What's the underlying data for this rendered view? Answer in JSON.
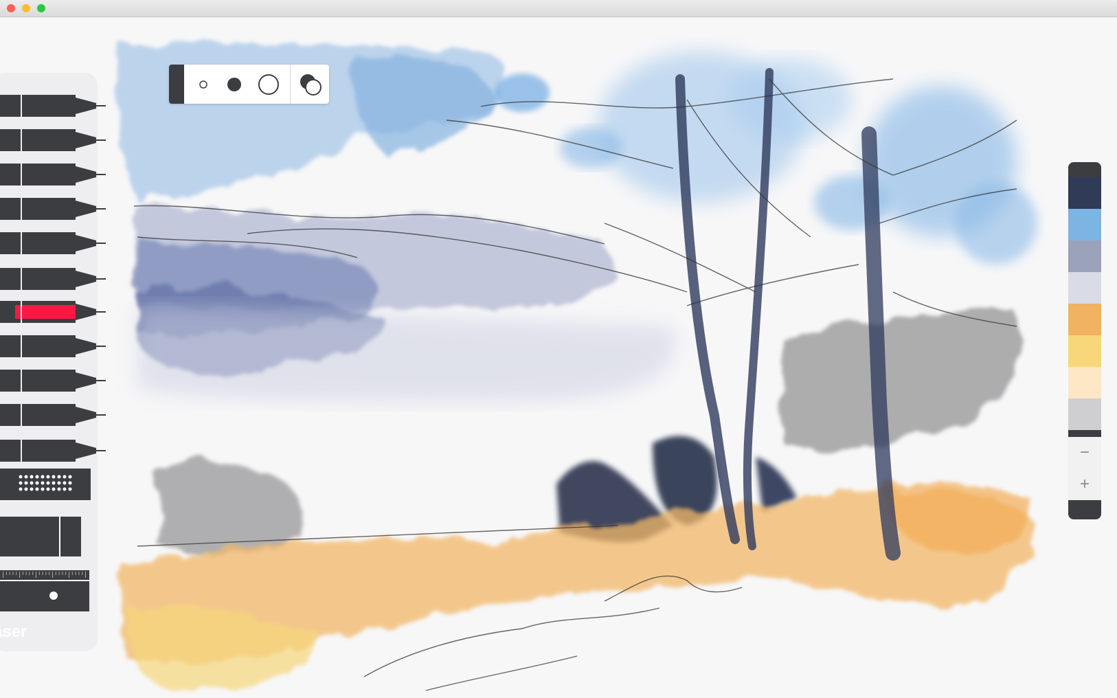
{
  "window": {
    "traffic_lights": [
      {
        "name": "close",
        "color": "#fe5f57"
      },
      {
        "name": "minimize",
        "color": "#febc2e"
      },
      {
        "name": "zoom",
        "color": "#28c840"
      }
    ]
  },
  "tools": {
    "items": [
      {
        "name": "technical-pen-tool"
      },
      {
        "name": "fineliner-tool"
      },
      {
        "name": "marker-tool"
      },
      {
        "name": "ballpoint-tool"
      },
      {
        "name": "felt-tip-tool"
      },
      {
        "name": "pencil-tool"
      },
      {
        "name": "watercolor-brush-tool",
        "accent": "#ff1744"
      },
      {
        "name": "airbrush-tool"
      },
      {
        "name": "crayon-tool"
      },
      {
        "name": "chalk-tool"
      },
      {
        "name": "fountain-pen-tool"
      },
      {
        "name": "smudge-tool"
      },
      {
        "name": "eraser-tool"
      },
      {
        "name": "ruler-tool"
      }
    ],
    "eraser_label": "aser"
  },
  "brush_size": {
    "options": [
      "small-dot",
      "medium-dot",
      "large-dot"
    ],
    "selected": "medium-dot",
    "opacity_toggle": "opacity-icon"
  },
  "palette": {
    "colors": [
      "#2f3b57",
      "#7cb4e4",
      "#9aa3ba",
      "#d9dbe6",
      "#f1b262",
      "#f7d77a",
      "#fde7c4",
      "#cfcfd1"
    ],
    "zoom_out_label": "−",
    "zoom_in_label": "+"
  }
}
